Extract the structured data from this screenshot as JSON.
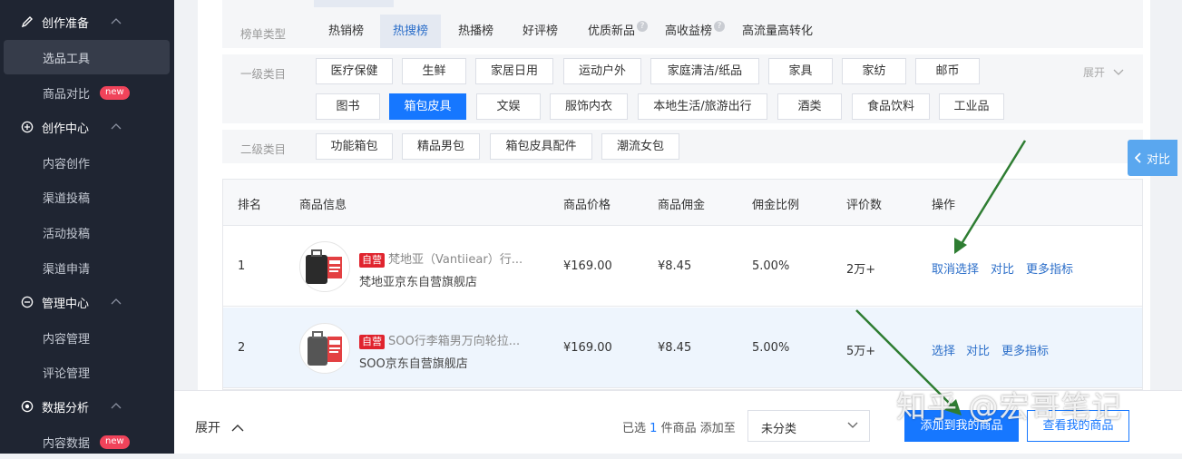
{
  "sidebar": {
    "groups": [
      {
        "label": "创作准备",
        "icon": "pencil-icon",
        "items": [
          {
            "label": "选品工具",
            "active": true
          },
          {
            "label": "商品对比",
            "badge": "new"
          }
        ]
      },
      {
        "label": "创作中心",
        "icon": "plus-circle-icon",
        "items": [
          {
            "label": "内容创作"
          },
          {
            "label": "渠道投稿"
          },
          {
            "label": "活动投稿"
          },
          {
            "label": "渠道申请"
          }
        ]
      },
      {
        "label": "管理中心",
        "icon": "minus-circle-icon",
        "items": [
          {
            "label": "内容管理"
          },
          {
            "label": "评论管理"
          }
        ]
      },
      {
        "label": "数据分析",
        "icon": "target-icon",
        "items": [
          {
            "label": "内容数据",
            "badge": "new"
          }
        ]
      }
    ]
  },
  "filters": {
    "ranking_label": "榜单类型",
    "ranking_tabs": [
      "热销榜",
      "热搜榜",
      "热播榜",
      "好评榜",
      "优质新品",
      "高收益榜",
      "高流量高转化"
    ],
    "ranking_active": "热搜榜",
    "level1_label": "一级类目",
    "level1_row1": [
      "医疗保健",
      "生鲜",
      "家居日用",
      "运动户外",
      "家庭清洁/纸品",
      "家具",
      "家纺",
      "邮币"
    ],
    "level1_row2": [
      "图书",
      "箱包皮具",
      "文娱",
      "服饰内衣",
      "本地生活/旅游出行",
      "酒类",
      "食品饮料",
      "工业品"
    ],
    "level1_active": "箱包皮具",
    "expand_label": "展开",
    "level2_label": "二级类目",
    "level2": [
      "功能箱包",
      "精品男包",
      "箱包皮具配件",
      "潮流女包"
    ]
  },
  "table": {
    "headers": [
      "排名",
      "商品信息",
      "商品价格",
      "商品佣金",
      "佣金比例",
      "评价数",
      "操作"
    ],
    "rows": [
      {
        "rank": "1",
        "tag": "自营",
        "title": "梵地亚（Vantiiear）行...",
        "shop": "梵地亚京东自营旗舰店",
        "price": "¥169.00",
        "commission": "¥8.45",
        "ratio": "5.00%",
        "reviews": "2万+",
        "op1": "取消选择",
        "op2": "对比",
        "op3": "更多指标"
      },
      {
        "rank": "2",
        "tag": "自营",
        "title": "SOO行李箱男万向轮拉...",
        "shop": "SOO京东自营旗舰店",
        "price": "¥169.00",
        "commission": "¥8.45",
        "ratio": "5.00%",
        "reviews": "5万+",
        "op1": "选择",
        "op2": "对比",
        "op3": "更多指标"
      }
    ]
  },
  "compare_tab": "对比",
  "bottom": {
    "expand": "展开",
    "selected_prefix": "已选",
    "selected_count": "1",
    "selected_suffix": "件商品 添加至",
    "category_value": "未分类",
    "add_button": "添加到我的商品",
    "view_button": "查看我的商品"
  },
  "watermark": "知乎 @宏哥笔记",
  "colors": {
    "accent": "#1677ff",
    "sidebar_bg": "#1f2532",
    "badge": "#f0435a",
    "arrow": "#2e7d32"
  }
}
